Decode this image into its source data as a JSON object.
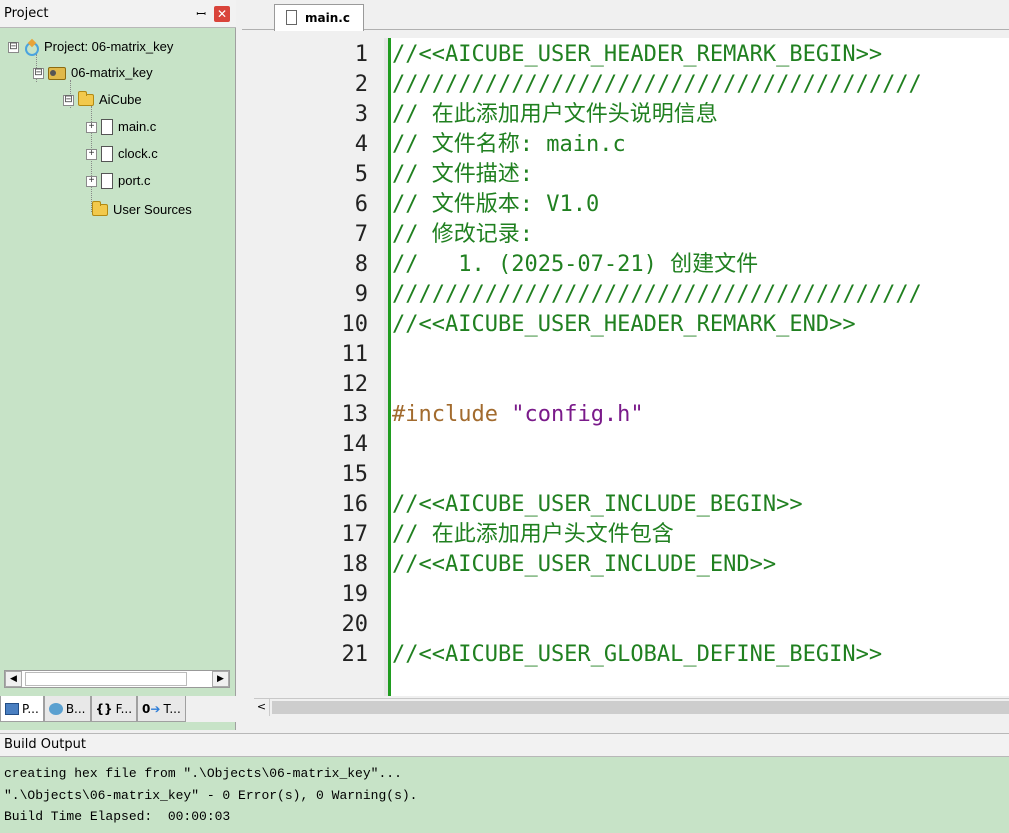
{
  "project_panel": {
    "title": "Project",
    "pin_glyph": "ꟷ",
    "close_glyph": "✕",
    "tree": [
      {
        "label": "Project: 06-matrix_key",
        "icon": "project-icon",
        "expander": "⊟"
      },
      {
        "label": "06-matrix_key",
        "icon": "target-group-icon",
        "expander": "⊟"
      },
      {
        "label": "AiCube",
        "icon": "folder-open-icon",
        "expander": "⊟"
      },
      {
        "label": "main.c",
        "icon": "file-icon",
        "expander": "+"
      },
      {
        "label": "clock.c",
        "icon": "file-icon",
        "expander": "+"
      },
      {
        "label": "port.c",
        "icon": "file-icon",
        "expander": "+"
      },
      {
        "label": "User Sources",
        "icon": "folder-icon",
        "expander": ""
      }
    ],
    "scroll_left": "◀",
    "scroll_right": "▶",
    "tabs": [
      {
        "label": "P...",
        "icon": "project-tab-icon"
      },
      {
        "label": "B...",
        "icon": "books-tab-icon"
      },
      {
        "label": "F...",
        "icon": "functions-tab-icon"
      },
      {
        "label": "T...",
        "icon": "templates-tab-icon"
      }
    ]
  },
  "editor": {
    "tab_label": "main.c",
    "scroll_left": "<",
    "lines": [
      {
        "num": "1",
        "text": "//<<AICUBE_USER_HEADER_REMARK_BEGIN>>",
        "kind": "comment"
      },
      {
        "num": "2",
        "text": "////////////////////////////////////////",
        "kind": "comment"
      },
      {
        "num": "3",
        "text": "// 在此添加用户文件头说明信息",
        "kind": "comment"
      },
      {
        "num": "4",
        "text": "// 文件名称: main.c",
        "kind": "comment"
      },
      {
        "num": "5",
        "text": "// 文件描述:",
        "kind": "comment"
      },
      {
        "num": "6",
        "text": "// 文件版本: V1.0",
        "kind": "comment"
      },
      {
        "num": "7",
        "text": "// 修改记录:",
        "kind": "comment"
      },
      {
        "num": "8",
        "text": "//   1. (2025-07-21) 创建文件",
        "kind": "comment"
      },
      {
        "num": "9",
        "text": "////////////////////////////////////////",
        "kind": "comment"
      },
      {
        "num": "10",
        "text": "//<<AICUBE_USER_HEADER_REMARK_END>>",
        "kind": "comment"
      },
      {
        "num": "11",
        "text": "",
        "kind": "plain"
      },
      {
        "num": "12",
        "text": "",
        "kind": "plain"
      },
      {
        "num": "13",
        "pp": "#include ",
        "str": "\"config.h\"",
        "kind": "include"
      },
      {
        "num": "14",
        "text": "",
        "kind": "plain"
      },
      {
        "num": "15",
        "text": "",
        "kind": "plain"
      },
      {
        "num": "16",
        "text": "//<<AICUBE_USER_INCLUDE_BEGIN>>",
        "kind": "comment"
      },
      {
        "num": "17",
        "text": "// 在此添加用户头文件包含",
        "kind": "comment"
      },
      {
        "num": "18",
        "text": "//<<AICUBE_USER_INCLUDE_END>>",
        "kind": "comment"
      },
      {
        "num": "19",
        "text": "",
        "kind": "plain"
      },
      {
        "num": "20",
        "text": "",
        "kind": "plain"
      },
      {
        "num": "21",
        "text": "//<<AICUBE_USER_GLOBAL_DEFINE_BEGIN>>",
        "kind": "comment"
      }
    ]
  },
  "build_output": {
    "title": "Build Output",
    "lines": [
      "creating hex file from \".\\Objects\\06-matrix_key\"...",
      "\".\\Objects\\06-matrix_key\" - 0 Error(s), 0 Warning(s).",
      "Build Time Elapsed:  00:00:03"
    ]
  }
}
